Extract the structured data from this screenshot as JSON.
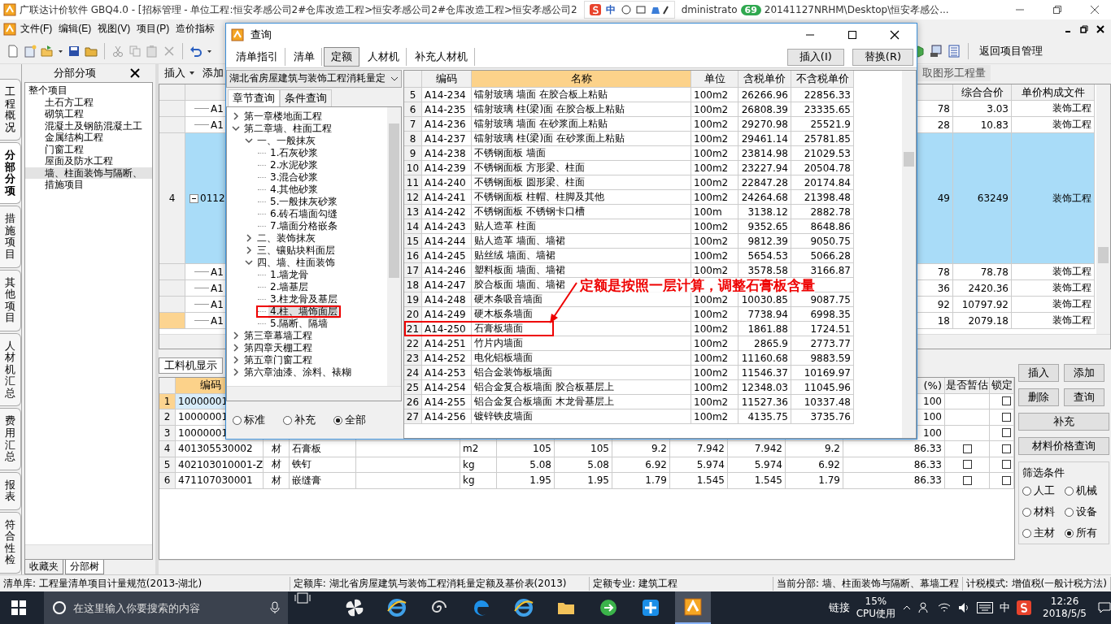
{
  "window": {
    "title_parts": [
      "广联达计价软件 GBQ4.0 - [招标管理 - 单位工程:恒安孝感公司2#仓库改造工程>恒安孝感公司2#仓库改造工程>恒安孝感公司2",
      "dministrato",
      "20141127NRHM\\Desktop\\恒安孝感公..."
    ],
    "ime_label": "中",
    "badge": "69"
  },
  "menu": [
    {
      "label": "文件(F)"
    },
    {
      "label": "编辑(E)"
    },
    {
      "label": "视图(V)"
    },
    {
      "label": "项目(P)"
    },
    {
      "label": "造价指标"
    }
  ],
  "toolbar": {
    "back_label": "返回项目管理"
  },
  "side_tabs": [
    {
      "label": "工程概况",
      "selected": false
    },
    {
      "label": "分部分项",
      "selected": true
    },
    {
      "label": "措施项目",
      "selected": false
    },
    {
      "label": "其他项目",
      "selected": false
    },
    {
      "label": "人材机汇总",
      "selected": false
    },
    {
      "label": "费用汇总",
      "selected": false
    },
    {
      "label": "报表",
      "selected": false
    },
    {
      "label": "符合性检",
      "selected": false
    }
  ],
  "left_panel": {
    "title": "分部分项",
    "tree": {
      "label": "整个项目",
      "selected": false,
      "children": [
        {
          "label": "土石方工程",
          "selected": false
        },
        {
          "label": "砌筑工程",
          "selected": false
        },
        {
          "label": "混凝土及钢筋混凝土工",
          "selected": false
        },
        {
          "label": "金属结构工程",
          "selected": false
        },
        {
          "label": "门窗工程",
          "selected": false
        },
        {
          "label": "屋面及防水工程",
          "selected": false
        },
        {
          "label": "墙、柱面装饰与隔断、",
          "selected": true
        },
        {
          "label": "措施项目",
          "selected": false
        }
      ]
    },
    "bottom_tabs": [
      {
        "label": "收藏夹",
        "selected": false
      },
      {
        "label": "分部树",
        "selected": true
      }
    ]
  },
  "main_toolbar": {
    "items": [
      {
        "label": "插入",
        "kind": "dropdown"
      },
      {
        "label": "添加",
        "kind": "plain"
      }
    ],
    "extract_label": "取图形工程量"
  },
  "upper_grid": {
    "columns": [
      {
        "label": "综合合价"
      },
      {
        "label": "单价构成文件"
      }
    ],
    "rows": [
      {
        "code": "A1",
        "column_a": "78",
        "total": "3.03",
        "file": "装饰工程",
        "kind": "item",
        "selected": false,
        "current": false
      },
      {
        "code": "A1",
        "column_a": "28",
        "total": "10.83",
        "file": "装饰工程",
        "kind": "item",
        "selected": false,
        "current": false
      },
      {
        "num": "4",
        "code": "0112",
        "column_a": "49",
        "total": "63249",
        "file": "装饰工程",
        "kind": "group",
        "expanded": true,
        "selected": true,
        "current": false
      },
      {
        "code": "A1",
        "column_a": "78",
        "total": "78.78",
        "file": "装饰工程",
        "kind": "item",
        "selected": false,
        "current": false
      },
      {
        "code": "A1",
        "column_a": "36",
        "total": "2420.36",
        "file": "装饰工程",
        "kind": "item",
        "selected": false,
        "current": false
      },
      {
        "code": "A1",
        "column_a": "92",
        "total": "10797.92",
        "file": "装饰工程",
        "kind": "item",
        "selected": false,
        "current": false
      },
      {
        "code": "A1",
        "column_a": "18",
        "total": "2079.18",
        "file": "装饰工程",
        "kind": "item",
        "selected": false,
        "current": true
      }
    ]
  },
  "bottom_grid": {
    "tab": "工料机显示",
    "columns": [
      {
        "label": "编码"
      },
      {
        "label": "(%)"
      },
      {
        "label": "是否暂估"
      },
      {
        "label": "锁定"
      }
    ],
    "rows": [
      {
        "num": "1",
        "code": "10000001",
        "pct": "100",
        "locked": false,
        "selected": true
      },
      {
        "num": "2",
        "code": "10000001",
        "pct": "100",
        "locked": false,
        "selected": false
      },
      {
        "num": "3",
        "code": "10000001",
        "pct": "100",
        "locked": false,
        "selected": false
      },
      {
        "num": "4",
        "code": "401305530002",
        "type": "材",
        "name": "石膏板",
        "unit": "m2",
        "values": [
          "105",
          "105",
          "9.2",
          "7.942",
          "7.942",
          "9.2"
        ],
        "pct": "86.33",
        "provisional": false,
        "locked": false,
        "selected": false
      },
      {
        "num": "5",
        "code": "402103010001-Z",
        "type": "材",
        "name": "铁钉",
        "unit": "kg",
        "values": [
          "5.08",
          "5.08",
          "6.92",
          "5.974",
          "5.974",
          "6.92"
        ],
        "pct": "86.33",
        "provisional": false,
        "locked": false,
        "selected": false
      },
      {
        "num": "6",
        "code": "471107030001",
        "type": "材",
        "name": "嵌缝膏",
        "unit": "kg",
        "values": [
          "1.95",
          "1.95",
          "1.79",
          "1.545",
          "1.545",
          "1.79"
        ],
        "pct": "86.33",
        "provisional": false,
        "locked": false,
        "selected": false
      }
    ]
  },
  "right_panel": {
    "buttons": [
      {
        "label": "插入",
        "kind": "half"
      },
      {
        "label": "添加",
        "kind": "half"
      },
      {
        "label": "删除",
        "kind": "half"
      },
      {
        "label": "查询",
        "kind": "half"
      },
      {
        "label": "补充",
        "kind": "full"
      },
      {
        "label": "材料价格查询",
        "kind": "full"
      }
    ],
    "filter_title": "筛选条件",
    "filters": [
      {
        "label": "人工",
        "selected": false
      },
      {
        "label": "机械",
        "selected": false
      },
      {
        "label": "材料",
        "selected": false
      },
      {
        "label": "设备",
        "selected": false
      },
      {
        "label": "主材",
        "selected": false
      },
      {
        "label": "所有",
        "selected": true
      }
    ]
  },
  "dialog": {
    "title": "查询",
    "tabs": [
      {
        "label": "清单指引",
        "selected": false
      },
      {
        "label": "清单",
        "selected": false
      },
      {
        "label": "定额",
        "selected": true
      },
      {
        "label": "人材机",
        "selected": false
      },
      {
        "label": "补充人材机",
        "selected": false
      }
    ],
    "actions": [
      {
        "label": "插入(I)"
      },
      {
        "label": "替换(R)"
      }
    ],
    "library": "湖北省房屋建筑与装饰工程消耗量定",
    "query_tabs": [
      {
        "label": "章节查询",
        "selected": true
      },
      {
        "label": "条件查询",
        "selected": false
      }
    ],
    "tree": [
      {
        "label": "第一章楼地面工程",
        "expanded": false,
        "selected": false
      },
      {
        "label": "第二章墙、柱面工程",
        "expanded": true,
        "selected": false,
        "children": [
          {
            "label": "一、一般抹灰",
            "expanded": true,
            "selected": false,
            "children": [
              {
                "label": "1.石灰砂浆",
                "selected": false
              },
              {
                "label": "2.水泥砂浆",
                "selected": false
              },
              {
                "label": "3.混合砂浆",
                "selected": false
              },
              {
                "label": "4.其他砂浆",
                "selected": false
              },
              {
                "label": "5.一般抹灰砂浆",
                "selected": false
              },
              {
                "label": "6.砖石墙面勾缝",
                "selected": false
              },
              {
                "label": "7.墙面分格嵌条",
                "selected": false
              }
            ]
          },
          {
            "label": "二、装饰抹灰",
            "expanded": false,
            "selected": false
          },
          {
            "label": "三、镶贴块料面层",
            "expanded": false,
            "selected": false
          },
          {
            "label": "四、墙、柱面装饰",
            "expanded": true,
            "selected": false,
            "children": [
              {
                "label": "1.墙龙骨",
                "selected": false
              },
              {
                "label": "2.墙基层",
                "selected": false
              },
              {
                "label": "3.柱龙骨及基层",
                "selected": false
              },
              {
                "label": "4.柱、墙饰面层",
                "selected": true,
                "highlighted": true
              },
              {
                "label": "5.隔断、隔墙",
                "selected": false
              }
            ]
          }
        ]
      },
      {
        "label": "第三章幕墙工程",
        "expanded": false,
        "selected": false
      },
      {
        "label": "第四章天棚工程",
        "expanded": false,
        "selected": false
      },
      {
        "label": "第五章门窗工程",
        "expanded": false,
        "selected": false
      },
      {
        "label": "第六章油漆、涂料、裱糊",
        "expanded": false,
        "selected": false
      }
    ],
    "scopes": [
      {
        "label": "标准",
        "selected": false
      },
      {
        "label": "补充",
        "selected": false
      },
      {
        "label": "全部",
        "selected": true
      }
    ],
    "columns": [
      {
        "label": "编码"
      },
      {
        "label": "名称"
      },
      {
        "label": "单位"
      },
      {
        "label": "含税单价"
      },
      {
        "label": "不含税单价"
      }
    ],
    "rows": [
      {
        "num": "5",
        "code": "A14-234",
        "name": "镭射玻璃 墙面 在胶合板上粘贴",
        "unit": "100m2",
        "price_tax": "26266.96",
        "price_net": "22856.33",
        "highlighted": false
      },
      {
        "num": "6",
        "code": "A14-235",
        "name": "镭射玻璃 柱(梁)面 在胶合板上粘贴",
        "unit": "100m2",
        "price_tax": "26808.39",
        "price_net": "23335.65",
        "highlighted": false
      },
      {
        "num": "7",
        "code": "A14-236",
        "name": "镭射玻璃 墙面 在砂浆面上粘贴",
        "unit": "100m2",
        "price_tax": "29270.98",
        "price_net": "25521.9",
        "highlighted": false
      },
      {
        "num": "8",
        "code": "A14-237",
        "name": "镭射玻璃 柱(梁)面 在砂浆面上粘贴",
        "unit": "100m2",
        "price_tax": "29461.14",
        "price_net": "25781.85",
        "highlighted": false
      },
      {
        "num": "9",
        "code": "A14-238",
        "name": "不锈钢面板 墙面",
        "unit": "100m2",
        "price_tax": "23814.98",
        "price_net": "21029.53",
        "highlighted": false
      },
      {
        "num": "10",
        "code": "A14-239",
        "name": "不锈钢面板 方形梁、柱面",
        "unit": "100m2",
        "price_tax": "23227.94",
        "price_net": "20504.78",
        "highlighted": false
      },
      {
        "num": "11",
        "code": "A14-240",
        "name": "不锈钢面板 圆形梁、柱面",
        "unit": "100m2",
        "price_tax": "22847.28",
        "price_net": "20174.84",
        "highlighted": false
      },
      {
        "num": "12",
        "code": "A14-241",
        "name": "不锈钢面板 柱帽、柱脚及其他",
        "unit": "100m2",
        "price_tax": "24264.68",
        "price_net": "21398.48",
        "highlighted": false
      },
      {
        "num": "13",
        "code": "A14-242",
        "name": "不锈钢面板 不锈钢卡口槽",
        "unit": "100m",
        "price_tax": "3138.12",
        "price_net": "2882.78",
        "highlighted": false
      },
      {
        "num": "14",
        "code": "A14-243",
        "name": "贴人造革 柱面",
        "unit": "100m2",
        "price_tax": "9352.65",
        "price_net": "8648.86",
        "highlighted": false
      },
      {
        "num": "15",
        "code": "A14-244",
        "name": "贴人造革 墙面、墙裙",
        "unit": "100m2",
        "price_tax": "9812.39",
        "price_net": "9050.75",
        "highlighted": false
      },
      {
        "num": "16",
        "code": "A14-245",
        "name": "贴丝绒 墙面、墙裙",
        "unit": "100m2",
        "price_tax": "5654.53",
        "price_net": "5066.28",
        "highlighted": false
      },
      {
        "num": "17",
        "code": "A14-246",
        "name": "塑料板面 墙面、墙裙",
        "unit": "100m2",
        "price_tax": "3578.58",
        "price_net": "3166.87",
        "highlighted": false
      },
      {
        "num": "18",
        "code": "A14-247",
        "name": "胶合板面 墙面、墙裙",
        "highlighted": false
      },
      {
        "num": "19",
        "code": "A14-248",
        "name": "硬木条吸音墙面",
        "unit": "100m2",
        "price_tax": "10030.85",
        "price_net": "9087.75",
        "highlighted": false
      },
      {
        "num": "20",
        "code": "A14-249",
        "name": "硬木板条墙面",
        "unit": "100m2",
        "price_tax": "7738.94",
        "price_net": "6998.35",
        "highlighted": false
      },
      {
        "num": "21",
        "code": "A14-250",
        "name": "石膏板墙面",
        "unit": "100m2",
        "price_tax": "1861.88",
        "price_net": "1724.51",
        "highlighted": true
      },
      {
        "num": "22",
        "code": "A14-251",
        "name": "竹片内墙面",
        "unit": "100m2",
        "price_tax": "2865.9",
        "price_net": "2773.77",
        "highlighted": false
      },
      {
        "num": "23",
        "code": "A14-252",
        "name": "电化铝板墙面",
        "unit": "100m2",
        "price_tax": "11160.68",
        "price_net": "9883.59",
        "highlighted": false
      },
      {
        "num": "24",
        "code": "A14-253",
        "name": "铝合金装饰板墙面",
        "unit": "100m2",
        "price_tax": "11546.37",
        "price_net": "10169.97",
        "highlighted": false
      },
      {
        "num": "25",
        "code": "A14-254",
        "name": "铝合金复合板墙面 胶合板基层上",
        "unit": "100m2",
        "price_tax": "12348.03",
        "price_net": "11045.96",
        "highlighted": false
      },
      {
        "num": "26",
        "code": "A14-255",
        "name": "铝合金复合板墙面 木龙骨基层上",
        "unit": "100m2",
        "price_tax": "11527.36",
        "price_net": "10337.48",
        "highlighted": false
      },
      {
        "num": "27",
        "code": "A14-256",
        "name": "镀锌铁皮墙面",
        "unit": "100m2",
        "price_tax": "4135.75",
        "price_net": "3735.76",
        "highlighted": false
      }
    ],
    "annotation": "定额是按照一层计算，调整石膏板含量"
  },
  "status_bar": [
    {
      "label": "清单库: 工程量清单项目计量规范(2013-湖北)"
    },
    {
      "label": "定额库: 湖北省房屋建筑与装饰工程消耗量定额及基价表(2013)"
    },
    {
      "label": "定额专业: 建筑工程"
    },
    {
      "label": "当前分部: 墙、柱面装饰与隔断、幕墙工程"
    },
    {
      "label": "计税模式: 增值税(一般计税方法)"
    }
  ],
  "taskbar": {
    "search_placeholder": "在这里输入你要搜索的内容",
    "apps": [
      {
        "kind": "fan",
        "selected": false
      },
      {
        "kind": "ie",
        "selected": false
      },
      {
        "kind": "spiral",
        "selected": false
      },
      {
        "kind": "edge",
        "selected": false
      },
      {
        "kind": "ie",
        "selected": false
      },
      {
        "kind": "folder",
        "selected": false
      },
      {
        "kind": "green",
        "selected": false
      },
      {
        "kind": "blue",
        "selected": false
      },
      {
        "kind": "app",
        "selected": true
      }
    ],
    "links_label": "链接",
    "cpu": "15%",
    "cpu_label": "CPU使用",
    "lang": "中",
    "time": "12:26",
    "date": "2018/5/5"
  }
}
